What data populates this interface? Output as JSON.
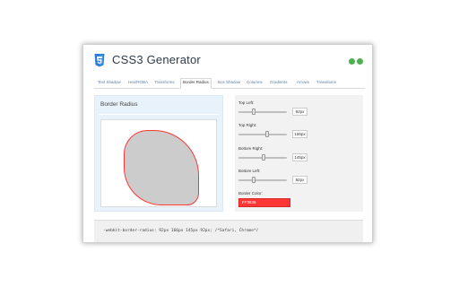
{
  "app": {
    "title": "CSS3 Generator",
    "logo_icon": "css3-shield-icon",
    "header_icons": [
      {
        "name": "settings-icon",
        "color": "#4caf50"
      },
      {
        "name": "help-icon",
        "color": "#4caf50"
      }
    ]
  },
  "tabs": [
    {
      "label": "Text Shadow",
      "active": false
    },
    {
      "label": "Hex/RGBA",
      "active": false
    },
    {
      "label": "Transforms",
      "active": false
    },
    {
      "label": "Border Radius",
      "active": true
    },
    {
      "label": "Box Shadow",
      "active": false
    },
    {
      "label": "Columns",
      "active": false
    },
    {
      "label": "Gradients",
      "active": false
    },
    {
      "label": "Arrows",
      "active": false
    },
    {
      "label": "Transitions",
      "active": false
    }
  ],
  "preview": {
    "title": "Border Radius",
    "shape_fill": "#cccccc",
    "border_color": "#ff3636"
  },
  "controls": {
    "top_left": {
      "label": "Top Left:",
      "value": "92px",
      "fraction": 0.32
    },
    "top_right": {
      "label": "Top Right:",
      "value": "166px",
      "fraction": 0.6
    },
    "bottom_right": {
      "label": "Bottom Right:",
      "value": "145px",
      "fraction": 0.52
    },
    "bottom_left": {
      "label": "Bottom Left:",
      "value": "92px",
      "fraction": 0.32
    },
    "border_color": {
      "label": "Border Color:",
      "value": "FF3636"
    }
  },
  "code": {
    "text": "-webkit-border-radius: 92px 166px 145px 92px; /*Safari, Chrome*/"
  },
  "colors": {
    "accent": "#ff3636",
    "link": "#5a7fa5",
    "panel_left": "#e8f2fb",
    "panel_right": "#f2f2f2"
  }
}
